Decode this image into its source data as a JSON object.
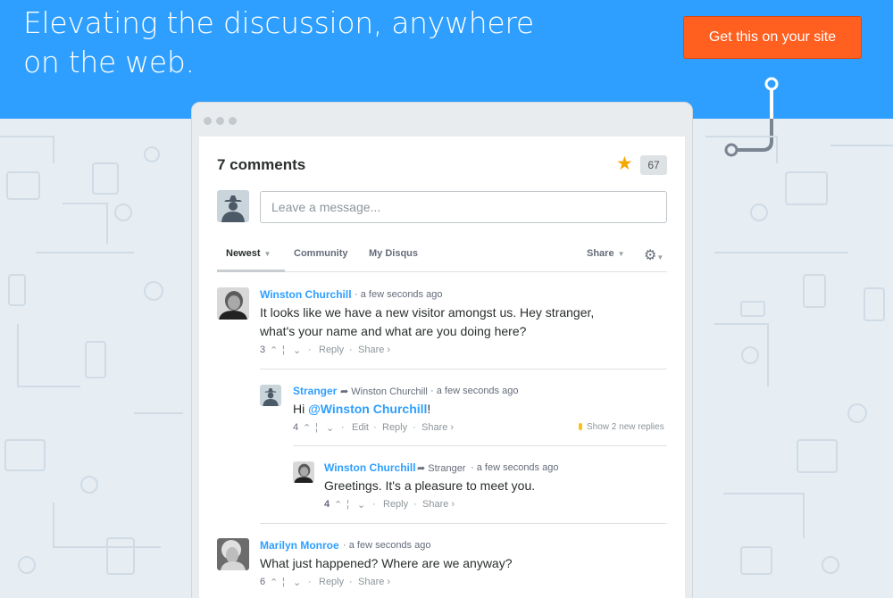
{
  "hero": {
    "headline": "Elevating the discussion, anywhere on the web.",
    "cta_label": "Get this on your site",
    "bg_color": "#2e9fff",
    "cta_color": "#ff5f1f"
  },
  "widget": {
    "comment_count_label": "7 comments",
    "score": "67",
    "message_placeholder": "Leave a message...",
    "tabs": [
      {
        "label": "Newest",
        "active": true
      },
      {
        "label": "Community",
        "active": false
      },
      {
        "label": "My Disqus",
        "active": false
      }
    ],
    "share_label": "Share",
    "icons": [
      "star-icon",
      "gear-icon",
      "upvote-icon",
      "downvote-icon",
      "reply-arrow-icon"
    ]
  },
  "comments": [
    {
      "author": "Winston Churchill",
      "time": "a few seconds ago",
      "text": "It looks like we have a new visitor amongst us. Hey stranger, what's your name and what are you doing here?",
      "votes": "3",
      "reply": "Reply",
      "share": "Share ›"
    },
    {
      "author": "Stranger",
      "reply_to": "Winston Churchill",
      "time": "a few seconds ago",
      "text_prefix": "Hi ",
      "mention": "@Winston Churchill",
      "text_suffix": "!",
      "votes": "4",
      "edit": "Edit",
      "reply": "Reply",
      "share": "Share ›",
      "new_replies": "Show 2 new replies"
    },
    {
      "author": "Winston Churchill",
      "reply_to": "Stranger",
      "time": "a few seconds ago",
      "text": "Greetings. It's a pleasure to meet you.",
      "votes": "4",
      "reply": "Reply",
      "share": "Share ›"
    },
    {
      "author": "Marilyn Monroe",
      "time": "a few seconds ago",
      "text": "What just happened? Where are we anyway?",
      "votes": "6",
      "reply": "Reply",
      "share": "Share ›"
    }
  ]
}
